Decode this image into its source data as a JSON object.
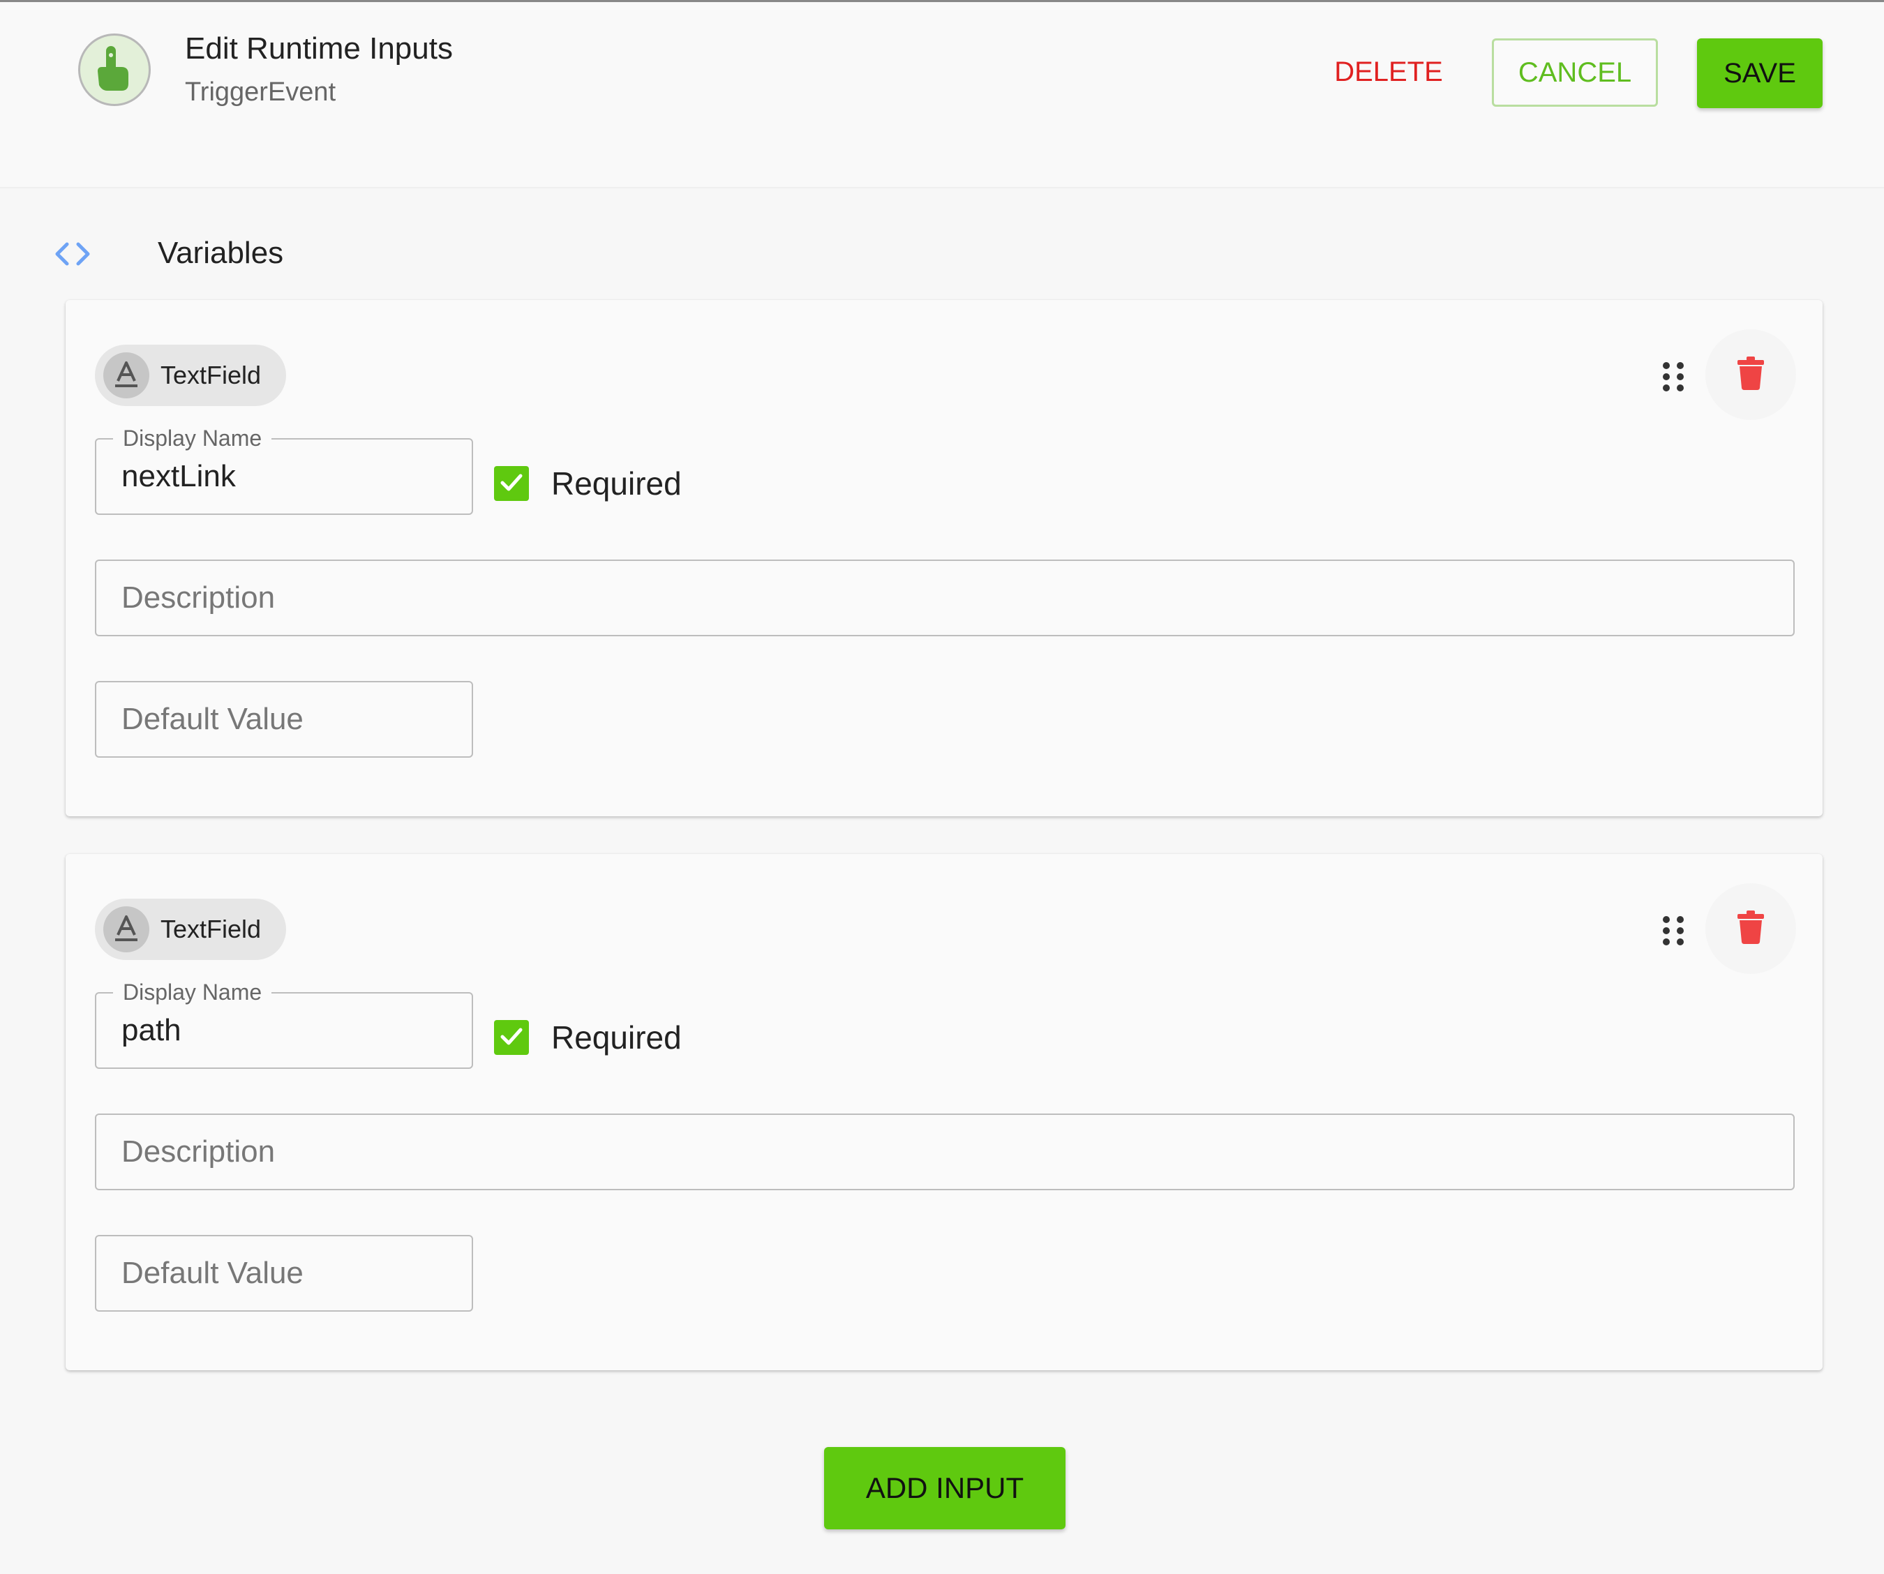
{
  "header": {
    "title": "Edit Runtime Inputs",
    "subtitle": "TriggerEvent",
    "delete_label": "DELETE",
    "cancel_label": "CANCEL",
    "save_label": "SAVE"
  },
  "section": {
    "title": "Variables"
  },
  "inputs": [
    {
      "type_label": "TextField",
      "display_name_label": "Display Name",
      "display_name_value": "nextLink",
      "required_checked": true,
      "required_label": "Required",
      "description_placeholder": "Description",
      "default_value_placeholder": "Default Value"
    },
    {
      "type_label": "TextField",
      "display_name_label": "Display Name",
      "display_name_value": "path",
      "required_checked": true,
      "required_label": "Required",
      "description_placeholder": "Description",
      "default_value_placeholder": "Default Value"
    }
  ],
  "footer": {
    "add_input_label": "ADD INPUT"
  },
  "icons": {
    "logo": "touch-hand-icon",
    "section": "code-brackets-icon",
    "chip": "text-a-icon",
    "drag": "drag-handle-icon",
    "delete": "trash-icon",
    "checkbox": "check-icon"
  },
  "colors": {
    "accent_green": "#5fc90f",
    "delete_red": "#e02121",
    "trash_red": "#ef4444",
    "code_icon_blue": "#6ea3f5",
    "logo_bg": "#e3f0d9",
    "logo_hand": "#5ba83a"
  }
}
